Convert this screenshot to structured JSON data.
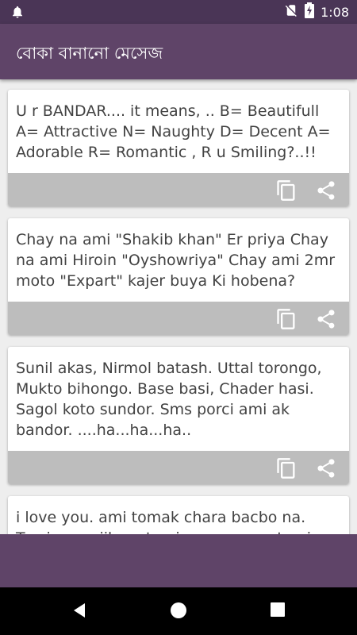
{
  "status": {
    "time": "1:08"
  },
  "app": {
    "title": "বোকা বানানো মেসেজ"
  },
  "messages": [
    {
      "text": "U r BANDAR.... it means, .. B= Beautifull A= Attractive N= Naughty D= Decent A= Adorable R= Romantic , R u Smiling?..!!"
    },
    {
      "text": "Chay na ami \"Shakib khan\" Er priya Chay na ami Hiroin \"Oyshowriya\" Chay ami 2mr moto \"Expart\" kajer buya Ki hobena?"
    },
    {
      "text": "Sunil akas, Nirmol batash. Uttal torongo, Mukto bihongo. Base basi, Chader hasi. Sagol koto sundor. Sms porci ami ak bandor. ....ha...ha...ha.."
    },
    {
      "text": "i love you. ami tomak chara bacbo na. Tomi amar jibon. tomi amar proan tomi amar"
    }
  ],
  "icons": {
    "notification": "bell-icon",
    "sim": "no-sim-icon",
    "battery": "battery-charging-icon",
    "copy": "copy-icon",
    "share": "share-icon",
    "back": "nav-back-icon",
    "home": "nav-home-icon",
    "recents": "nav-recents-icon"
  },
  "colors": {
    "statusbar": "#4a3556",
    "appbar": "#5f4468",
    "card_actions": "#bdbdbd",
    "background": "#eeeeee"
  }
}
